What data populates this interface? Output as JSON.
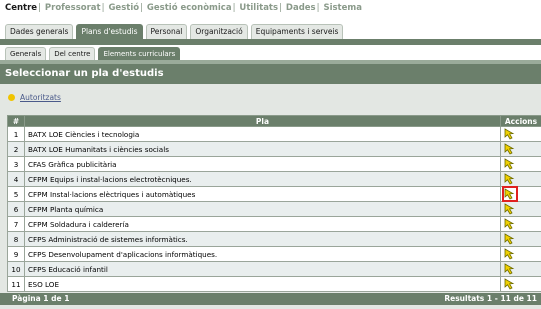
{
  "topnav": [
    "Centre",
    "Professorat",
    "Gestió",
    "Gestió econòmica",
    "Utilitats",
    "Dades",
    "Sistema"
  ],
  "tabs": [
    "Dades generals",
    "Plans d'estudis",
    "Personal",
    "Organització",
    "Equipaments i serveis"
  ],
  "subtabs": [
    "Generals",
    "Del centre",
    "Elements curriculars"
  ],
  "title": "Seleccionar un pla d'estudis",
  "filter_label": "Autoritzats",
  "table": {
    "headers": [
      "#",
      "Pla",
      "Accions"
    ],
    "rows": [
      {
        "num": "1",
        "pla": "BATX LOE Ciències i tecnologia"
      },
      {
        "num": "2",
        "pla": "BATX LOE Humanitats i ciències socials"
      },
      {
        "num": "3",
        "pla": "CFAS Gràfica publicitària"
      },
      {
        "num": "4",
        "pla": "CFPM Equips i instal·lacions electrotècniques."
      },
      {
        "num": "5",
        "pla": "CFPM Instal·lacions elèctriques i automàtiques"
      },
      {
        "num": "6",
        "pla": "CFPM Planta química"
      },
      {
        "num": "7",
        "pla": "CFPM Soldadura i calderería"
      },
      {
        "num": "8",
        "pla": "CFPS Administració de sistemes informàtics."
      },
      {
        "num": "9",
        "pla": "CFPS Desenvolupament d'aplicacions informàtiques."
      },
      {
        "num": "10",
        "pla": "CFPS Educació infantil"
      },
      {
        "num": "11",
        "pla": "ESO LOE"
      }
    ]
  },
  "footer": {
    "page": "Pàgina 1 de 1",
    "results": "Resultats 1 - 11 de 11"
  },
  "colors": {
    "header": "#6b7f6b",
    "panel": "#e3e7e3",
    "highlight": "#e02020",
    "action_icon": "#f0d000"
  },
  "icons": {
    "action": "pointer-arrow-icon",
    "filter": "yellow-dot-icon"
  }
}
